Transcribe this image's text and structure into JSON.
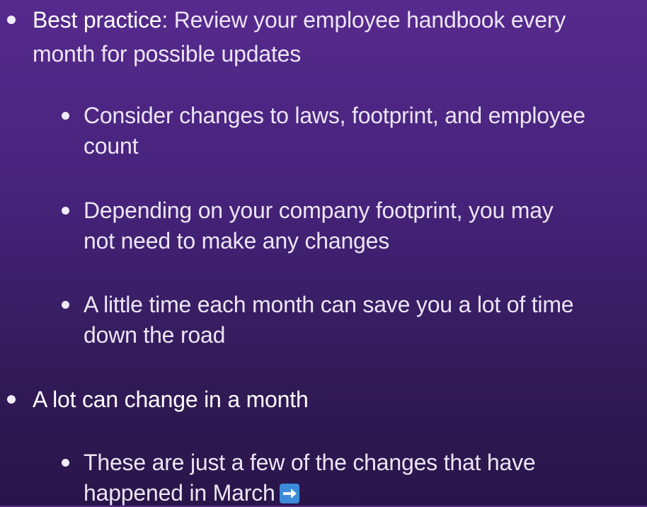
{
  "bullets": [
    {
      "bold_lead": "Best practice",
      "rest": ": Review your employee handbook every",
      "line2": "month for possible updates",
      "subs": [
        {
          "line1": "Consider changes to laws, footprint, and employee",
          "line2": "count"
        },
        {
          "line1": "Depending on your company footprint,  you may",
          "line2": "not need to make any changes"
        },
        {
          "line1": "A little time each month can save you a lot of time",
          "line2": "down the road"
        }
      ]
    },
    {
      "text": "A lot can change in a month",
      "subs": [
        {
          "line1": "These are just a few of the changes that have",
          "line2": "happened in March",
          "icon": "right-arrow-icon"
        }
      ]
    }
  ],
  "colors": {
    "text": "#f2ecfa",
    "background_top": "#562a8d",
    "background_bottom": "#29154a",
    "arrow_icon": "#3d8fe0"
  }
}
